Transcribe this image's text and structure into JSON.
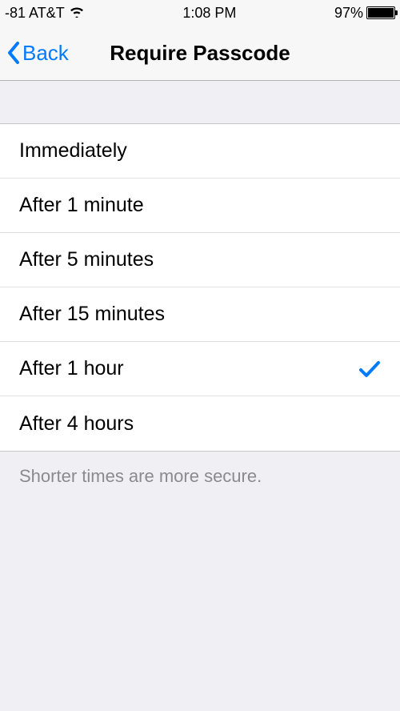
{
  "statusBar": {
    "signal": "-81 AT&T",
    "time": "1:08 PM",
    "batteryPercent": "97%"
  },
  "nav": {
    "back": "Back",
    "title": "Require Passcode"
  },
  "options": [
    {
      "label": "Immediately",
      "selected": false
    },
    {
      "label": "After 1 minute",
      "selected": false
    },
    {
      "label": "After 5 minutes",
      "selected": false
    },
    {
      "label": "After 15 minutes",
      "selected": false
    },
    {
      "label": "After 1 hour",
      "selected": true
    },
    {
      "label": "After 4 hours",
      "selected": false
    }
  ],
  "footer": "Shorter times are more secure."
}
